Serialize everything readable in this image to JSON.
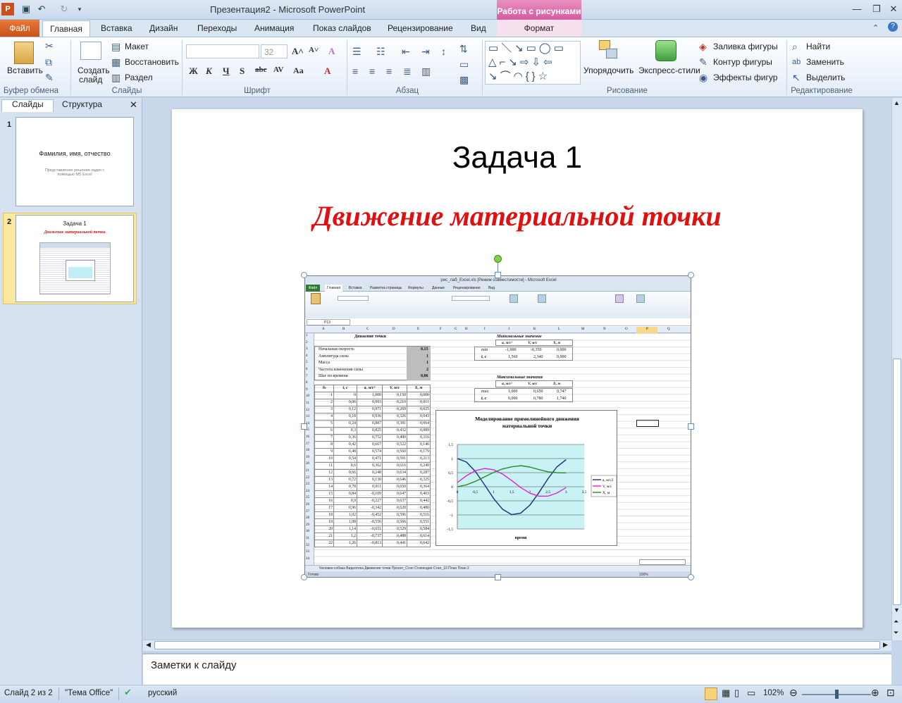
{
  "window": {
    "title": "Презентация2  -  Microsoft PowerPoint",
    "context_group": "Работа с рисунками"
  },
  "tabs": {
    "file": "Файл",
    "items": [
      "Главная",
      "Вставка",
      "Дизайн",
      "Переходы",
      "Анимация",
      "Показ слайдов",
      "Рецензирование",
      "Вид"
    ],
    "format": "Формат"
  },
  "ribbon": {
    "clipboard": {
      "paste": "Вставить",
      "label": "Буфер обмена"
    },
    "slides": {
      "new_slide": "Создать",
      "new_slide2": "слайд",
      "layout": "Макет",
      "reset": "Восстановить",
      "section": "Раздел",
      "label": "Слайды"
    },
    "font": {
      "size": "32",
      "label": "Шрифт"
    },
    "paragraph": {
      "label": "Абзац"
    },
    "drawing": {
      "arrange": "Упорядочить",
      "quick_styles": "Экспресс-стили",
      "fill": "Заливка фигуры",
      "outline": "Контур фигуры",
      "effects": "Эффекты фигур",
      "label": "Рисование"
    },
    "editing": {
      "find": "Найти",
      "replace": "Заменить",
      "select": "Выделить",
      "label": "Редактирование"
    }
  },
  "panel": {
    "tab_slides": "Слайды",
    "tab_outline": "Структура",
    "slide1": {
      "num": "1",
      "title": "Фамилия, имя, отчество",
      "subtitle": "Представление решения задач с помощью MS Excel"
    },
    "slide2": {
      "num": "2",
      "title": "Задача 1",
      "subtitle": "Движение материальной точки"
    }
  },
  "slide": {
    "title": "Задача 1",
    "subtitle": "Движение материальной точки"
  },
  "notes": {
    "placeholder": "Заметки к слайду"
  },
  "status": {
    "slide": "Слайд 2 из 2",
    "theme": "\"Тема Office\"",
    "language": "русский",
    "zoom": "102%"
  },
  "excel": {
    "title": "рис_лаб_Excel.xls  [Режим совместимости]  -  Microsoft Excel",
    "tabs": [
      "Файл",
      "Главная",
      "Вставка",
      "Разметка страницы",
      "Формулы",
      "Данные",
      "Рецензирование",
      "Вид"
    ],
    "name_box": "P13",
    "columns": [
      "A",
      "B",
      "C",
      "D",
      "E",
      "F",
      "G",
      "H",
      "I",
      "J",
      "K",
      "L",
      "M",
      "N",
      "O",
      "P",
      "Q"
    ],
    "sheet_title": "Движение точки",
    "params": [
      {
        "label": "Начальная скорость",
        "value": "0,15"
      },
      {
        "label": "Амплитуда силы",
        "value": "1"
      },
      {
        "label": "Масса",
        "value": "1"
      },
      {
        "label": "Частота изменения силы",
        "value": "2"
      },
      {
        "label": "Шаг по времени",
        "value": "0,06"
      }
    ],
    "min_title": "Минимальные  значение",
    "max_title": "Максимальные значение",
    "minmax_headers": [
      "a, м/с²",
      "V, м/с",
      "X, м"
    ],
    "min_rows": [
      {
        "label": "min",
        "values": [
          "-1,000",
          "-0,350",
          "0,000"
        ]
      },
      {
        "label": "t, c",
        "values": [
          "1,560",
          "2,340",
          "0,000"
        ]
      }
    ],
    "max_rows": [
      {
        "label": "max",
        "values": [
          "1,000",
          "0,650",
          "0,747"
        ]
      },
      {
        "label": "t, c",
        "values": [
          "0,000",
          "0,780",
          "1,740"
        ]
      }
    ],
    "table_headers": [
      "№",
      "t, c",
      "a, м/с²",
      "V, м/с",
      "X, м"
    ],
    "table_rows": [
      [
        "1",
        "0",
        "1,000",
        "0,150",
        "0,000"
      ],
      [
        "2",
        "0,06",
        "0,993",
        "0,210",
        "0,011"
      ],
      [
        "3",
        "0,12",
        "0,971",
        "0,269",
        "0,025"
      ],
      [
        "4",
        "0,18",
        "0,936",
        "0,326",
        "0,043"
      ],
      [
        "5",
        "0,24",
        "0,887",
        "0,381",
        "0,064"
      ],
      [
        "6",
        "0,3",
        "0,825",
        "0,432",
        "0,089"
      ],
      [
        "7",
        "0,36",
        "0,752",
        "0,480",
        "0,116"
      ],
      [
        "8",
        "0,42",
        "0,667",
        "0,522",
        "0,146"
      ],
      [
        "9",
        "0,48",
        "0,574",
        "0,560",
        "0,179"
      ],
      [
        "10",
        "0,54",
        "0,471",
        "0,591",
        "0,213"
      ],
      [
        "11",
        "0,6",
        "0,362",
        "0,616",
        "0,249"
      ],
      [
        "12",
        "0,66",
        "0,248",
        "0,634",
        "0,287"
      ],
      [
        "13",
        "0,72",
        "0,130",
        "0,646",
        "0,325"
      ],
      [
        "14",
        "0,78",
        "0,011",
        "0,650",
        "0,364"
      ],
      [
        "15",
        "0,84",
        "-0,109",
        "0,647",
        "0,403"
      ],
      [
        "16",
        "0,9",
        "-0,227",
        "0,637",
        "0,442"
      ],
      [
        "17",
        "0,96",
        "-0,342",
        "0,620",
        "0,480"
      ],
      [
        "18",
        "1,02",
        "-0,452",
        "0,596",
        "0,516"
      ],
      [
        "19",
        "1,08",
        "-0,556",
        "0,566",
        "0,551"
      ],
      [
        "20",
        "1,14",
        "-0,651",
        "0,529",
        "0,584"
      ],
      [
        "21",
        "1,2",
        "-0,737",
        "0,488",
        "0,614"
      ],
      [
        "22",
        "1,26",
        "-0,813",
        "0,441",
        "0,642"
      ]
    ],
    "sheet_tabs": "Человек-собака   Видеотека   Движение точки   Проект_Стил   Стипендия   Стил_10   План   План 2",
    "status": "Готово",
    "zoom": "100%"
  },
  "chart_data": {
    "type": "line",
    "title": "Моделирование прямолинейного движения материальной точки",
    "xlabel": "время",
    "ylabel": "",
    "xlim": [
      0,
      3.5
    ],
    "ylim": [
      -1.5,
      1.5
    ],
    "xticks": [
      "0",
      "0,5",
      "1",
      "1,5",
      "2",
      "2,5",
      "3",
      "3,5"
    ],
    "yticks": [
      "1,5",
      "1",
      "0,5",
      "0",
      "-0,5",
      "-1",
      "-1,5"
    ],
    "legend_position": "right",
    "series": [
      {
        "name": "a, м/с2",
        "color": "#1f2a78",
        "x": [
          0,
          0.25,
          0.5,
          0.75,
          1,
          1.25,
          1.5,
          1.75,
          2,
          2.25,
          2.5,
          2.75,
          3
        ],
        "y": [
          1,
          0.878,
          0.54,
          0.071,
          -0.416,
          -0.801,
          -0.99,
          -0.936,
          -0.654,
          -0.211,
          0.284,
          0.709,
          0.96
        ]
      },
      {
        "name": "V, м/с",
        "color": "#e020d8",
        "x": [
          0,
          0.25,
          0.5,
          0.75,
          1,
          1.25,
          1.5,
          1.75,
          2,
          2.25,
          2.5,
          2.75,
          3
        ],
        "y": [
          0.15,
          0.39,
          0.571,
          0.647,
          0.605,
          0.449,
          0.22,
          -0.03,
          -0.227,
          -0.336,
          -0.334,
          -0.222,
          -0.03
        ]
      },
      {
        "name": "X, м",
        "color": "#2a8a2a",
        "x": [
          0,
          0.25,
          0.5,
          0.75,
          1,
          1.25,
          1.5,
          1.75,
          2,
          2.25,
          2.5,
          2.75,
          3
        ],
        "y": [
          0,
          0.068,
          0.192,
          0.35,
          0.509,
          0.634,
          0.707,
          0.747,
          0.7,
          0.61,
          0.53,
          0.5,
          0.49
        ]
      }
    ]
  },
  "colors": {
    "accent": "#c0392b",
    "file_tab": "#d35a1f",
    "context": "#d35c9e"
  }
}
